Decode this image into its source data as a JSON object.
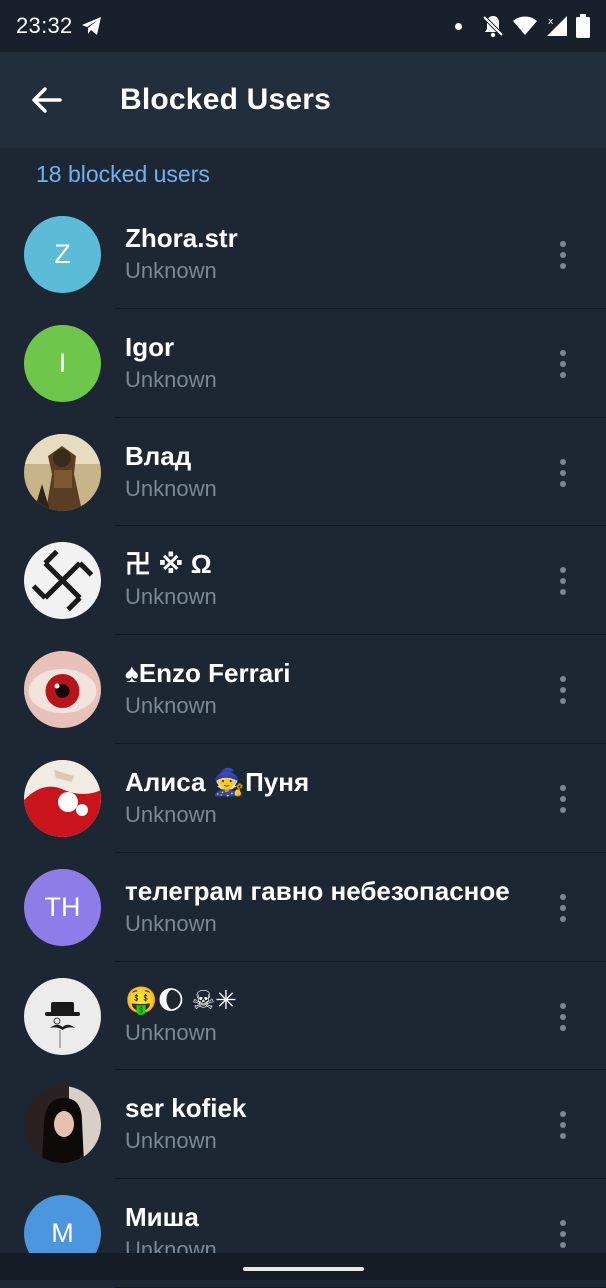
{
  "status_bar": {
    "time": "23:32",
    "icons": [
      "telegram-icon",
      "notification-dot",
      "bell-off-icon",
      "wifi-icon",
      "signal-icon",
      "battery-icon"
    ]
  },
  "header": {
    "title": "Blocked Users",
    "back_icon": "arrow-left-icon"
  },
  "section_label": "18 blocked users",
  "users": [
    {
      "name": "Zhora.str",
      "status": "Unknown",
      "avatar_type": "initials",
      "initials": "Z",
      "avatar_color": "#5cbbd6"
    },
    {
      "name": "Igor",
      "status": "Unknown",
      "avatar_type": "initials",
      "initials": "I",
      "avatar_color": "#6ec74a"
    },
    {
      "name": "Влад",
      "status": "Unknown",
      "avatar_type": "photo",
      "photo_desc": "armored-figure"
    },
    {
      "name": " 卍 ※ Ω",
      "status": "Unknown",
      "avatar_type": "photo",
      "photo_desc": "black-white-symbol"
    },
    {
      "name": "♠Enzo Ferrari",
      "status": "Unknown",
      "avatar_type": "photo",
      "photo_desc": "red-eye"
    },
    {
      "name": "Алиса 🧙Пуня",
      "status": "Unknown",
      "avatar_type": "photo",
      "photo_desc": "red-cartoon"
    },
    {
      "name": "телеграм гавно небезопасное",
      "status": "Unknown",
      "avatar_type": "initials",
      "initials": "ТН",
      "avatar_color": "#8e7de8"
    },
    {
      "name": "🤑🌔 ☠✳",
      "status": "Unknown",
      "avatar_type": "photo",
      "photo_desc": "hat-mustache"
    },
    {
      "name": "ser kofiek",
      "status": "Unknown",
      "avatar_type": "photo",
      "photo_desc": "girl-portrait"
    },
    {
      "name": "Миша",
      "status": "Unknown",
      "avatar_type": "initials",
      "initials": "М",
      "avatar_color": "#4c96dd"
    }
  ],
  "colors": {
    "background": "#1d2733",
    "appbar": "#232e3c",
    "accent": "#6db3f2",
    "secondary_text": "#7a8795"
  }
}
